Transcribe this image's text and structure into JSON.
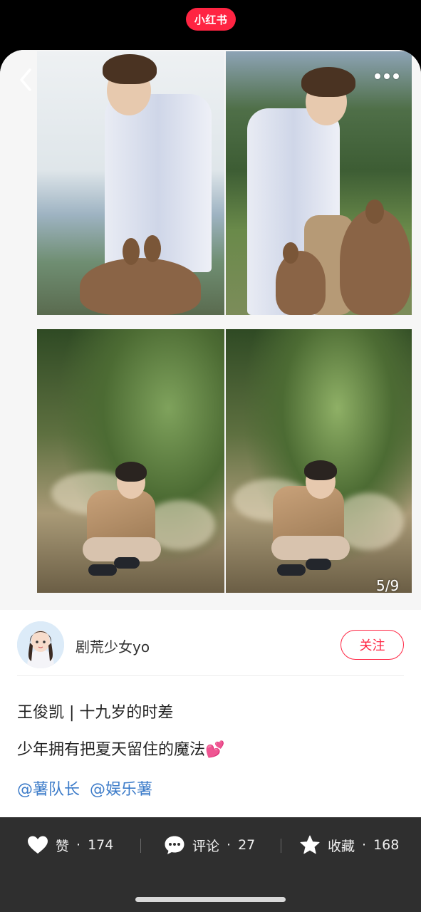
{
  "top_bar": {
    "brand": "小红书"
  },
  "gallery": {
    "page_indicator": "5/9"
  },
  "author": {
    "name": "剧荒少女yo",
    "follow_label": "关注"
  },
  "post": {
    "title": "王俊凯 | 十九岁的时差",
    "body": "少年拥有把夏天留住的魔法",
    "body_emoji": "💕",
    "mentions": [
      "@薯队长",
      "@娱乐薯"
    ]
  },
  "actions": {
    "like": {
      "label": "赞",
      "count": "174"
    },
    "comment": {
      "label": "评论",
      "count": "27"
    },
    "collect": {
      "label": "收藏",
      "count": "168"
    },
    "dot": "·"
  },
  "colors": {
    "brand": "#ff2442",
    "mention": "#3d7cc9",
    "bar": "#2f2f2f"
  }
}
